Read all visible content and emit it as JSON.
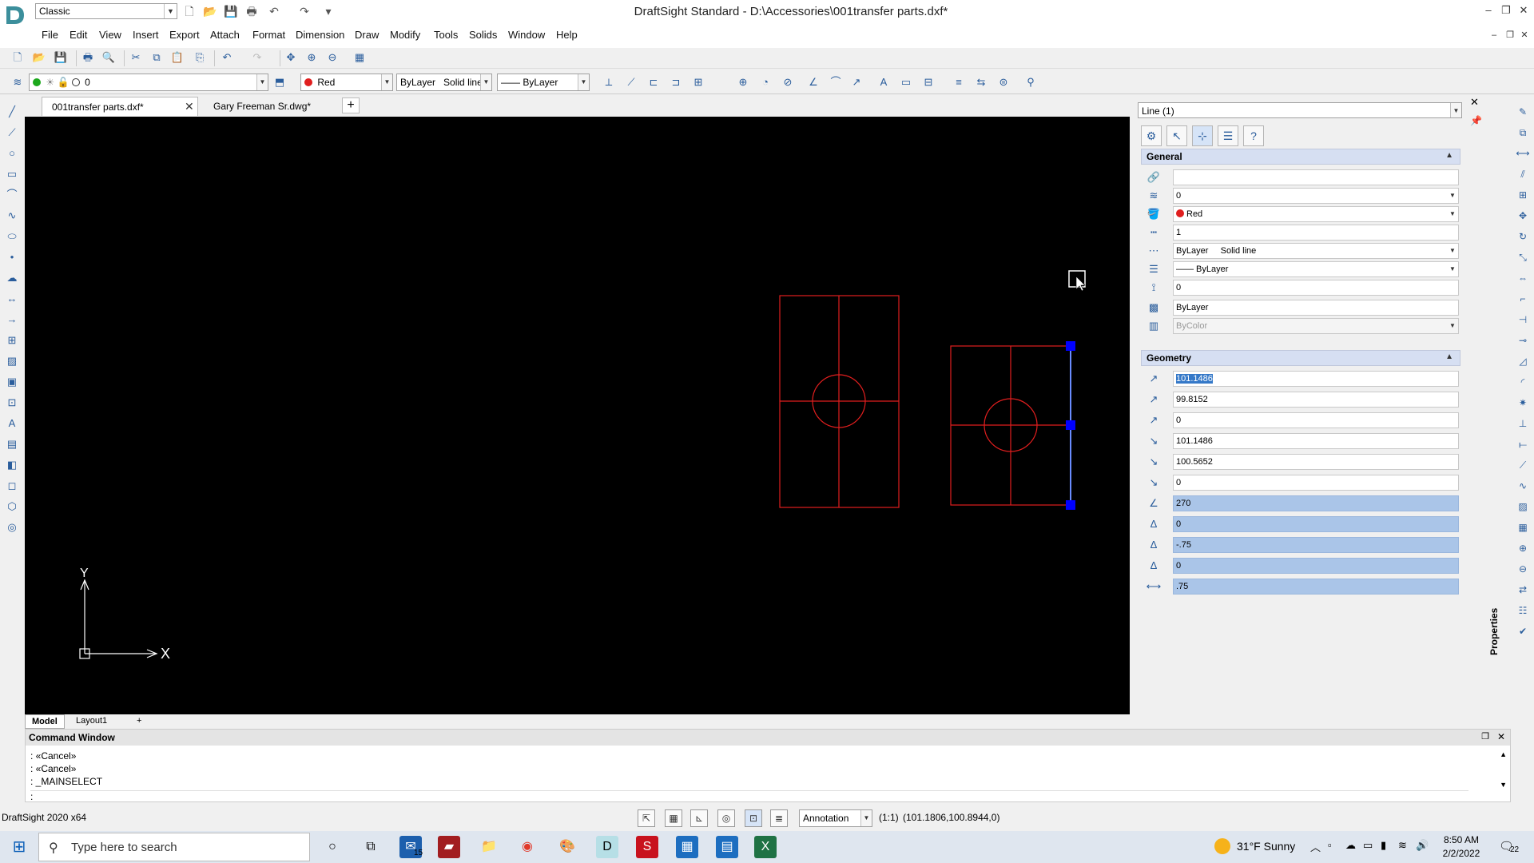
{
  "app": {
    "title": "DraftSight Standard - D:\\Accessories\\001transfer parts.dxf*",
    "workspace": "Classic"
  },
  "menu": [
    "File",
    "Edit",
    "View",
    "Insert",
    "Export",
    "Attach",
    "Format",
    "Dimension",
    "Draw",
    "Modify",
    "Tools",
    "Solids",
    "Window",
    "Help"
  ],
  "layer_toolbar": {
    "layer": "0",
    "color": "Red",
    "linetype_by": "ByLayer",
    "linetype_style": "Solid line",
    "lineweight": "—— ByLayer"
  },
  "colors": {
    "accent": "#3478c8",
    "drawing_red": "#e01e1e",
    "grip_blue": "#0000ff",
    "canvas": "#000000"
  },
  "doc_tabs": [
    {
      "label": "001transfer parts.dxf*",
      "active": true
    },
    {
      "label": "Gary Freeman Sr.dwg*",
      "active": false
    }
  ],
  "layout_tabs": [
    "Model",
    "Layout1",
    "+"
  ],
  "axes": {
    "x": "X",
    "y": "Y"
  },
  "properties": {
    "selection": "Line (1)",
    "general_header": "General",
    "geometry_header": "Geometry",
    "general": {
      "hyperlink": "",
      "layer": "0",
      "color": "Red",
      "linetype_scale": "1",
      "linetype": "ByLayer     Solid line",
      "lineweight": "—— ByLayer",
      "thickness": "0",
      "transparency": "ByLayer",
      "plot_style": "ByColor"
    },
    "geometry": {
      "start_x": "101.1486",
      "start_y": "99.8152",
      "start_z": "0",
      "end_x": "101.1486",
      "end_y": "100.5652",
      "end_z": "0",
      "angle": "270",
      "delta_x": "0",
      "delta_y": "-.75",
      "delta_z": "0",
      "length": ".75"
    },
    "panel_label": "Properties"
  },
  "command_window": {
    "title": "Command Window",
    "lines": [
      ": «Cancel»",
      ": «Cancel»",
      ": _MAINSELECT",
      ":"
    ]
  },
  "status": {
    "app_version": "DraftSight 2020 x64",
    "annotation": "Annotation",
    "scale": "(1:1)",
    "coords": "(101.1806,100.8944,0)"
  },
  "taskbar": {
    "search_placeholder": "Type here to search",
    "weather": "31°F  Sunny",
    "time": "8:50 AM",
    "date": "2/2/2022",
    "notifications": "22",
    "mail_badge": "15"
  }
}
